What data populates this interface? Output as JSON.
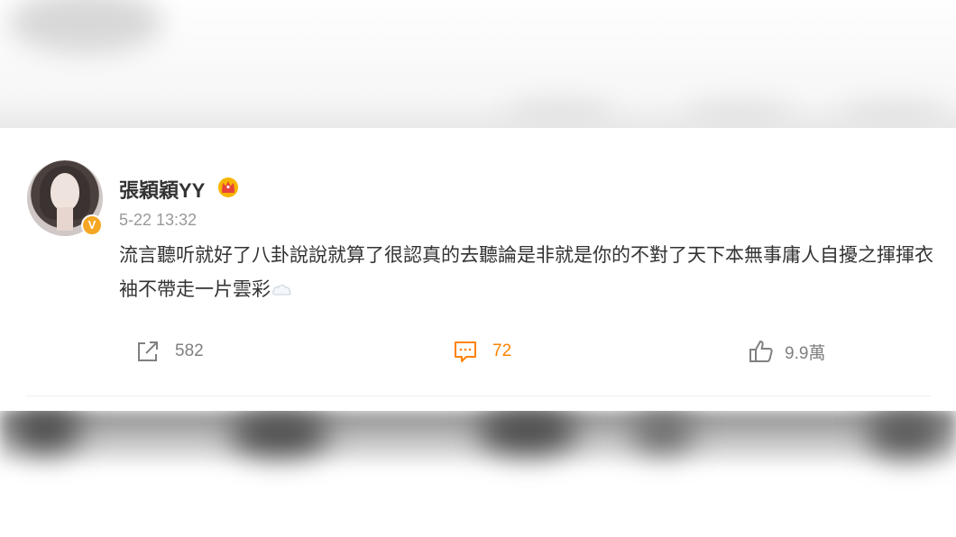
{
  "post": {
    "author": "張穎穎YY",
    "author_badge_icon": "crown-icon",
    "verified_badge": "V",
    "timestamp": "5-22 13:32",
    "text": "流言聽听就好了八卦說說就算了很認真的去聽論是非就是你的不對了天下本無事庸人自擾之揮揮衣袖不帶走一片雲彩",
    "trailing_icon": "cloud-icon"
  },
  "actions": {
    "repost": {
      "icon": "share-icon",
      "count": "582"
    },
    "comment": {
      "icon": "comment-icon",
      "count": "72"
    },
    "like": {
      "icon": "thumbs-up-icon",
      "count": "9.9萬"
    }
  },
  "colors": {
    "accent_orange": "#ff8200",
    "verified_badge": "#f5a623",
    "muted_text": "#999999",
    "body_text": "#333333"
  }
}
